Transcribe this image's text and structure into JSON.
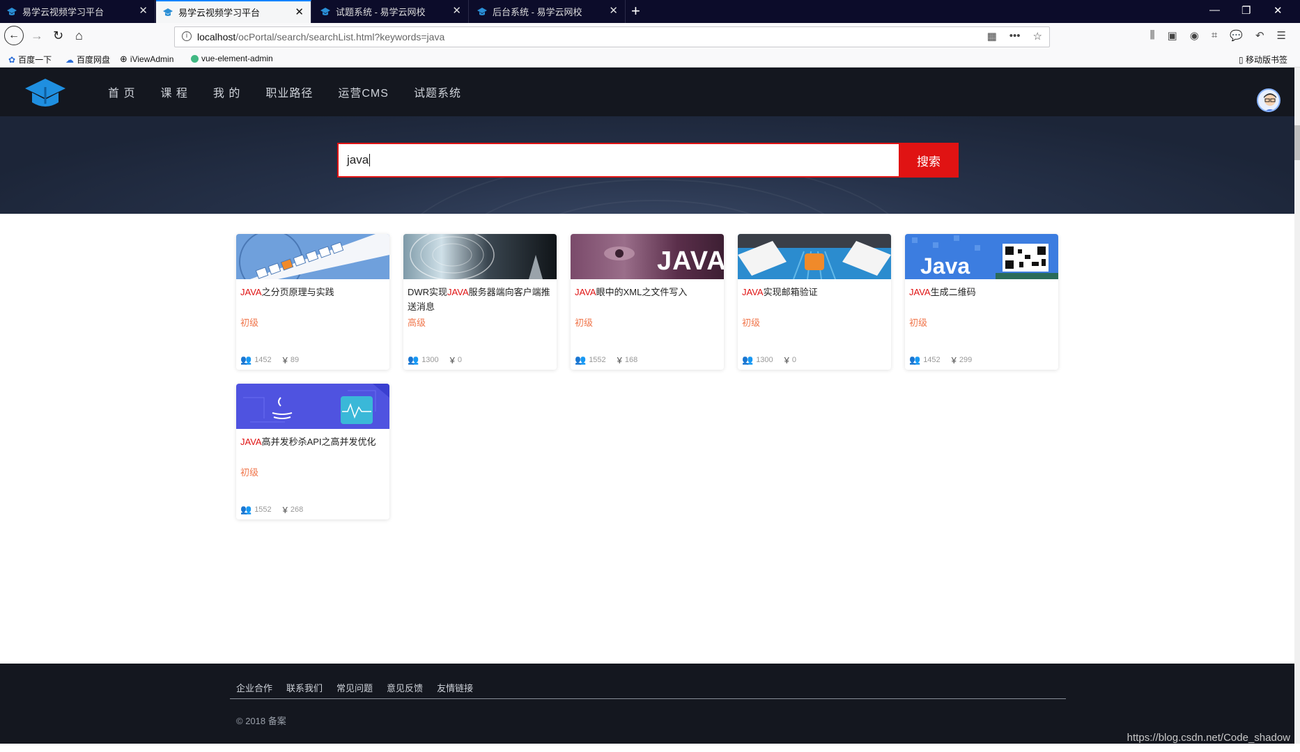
{
  "browser": {
    "tabs": [
      {
        "title": "易学云视频学习平台",
        "active": false
      },
      {
        "title": "易学云视频学习平台",
        "active": true
      },
      {
        "title": "试题系统 - 易学云网校",
        "active": false
      },
      {
        "title": "后台系统 - 易学云网校",
        "active": false
      }
    ],
    "url_host": "localhost",
    "url_path": "/ocPortal/search/searchList.html?keywords=java",
    "bookmarks": [
      "百度一下",
      "百度网盘",
      "iViewAdmin",
      "vue-element-admin"
    ],
    "mobile_bookmarks": "移动版书签"
  },
  "site": {
    "menu": [
      "首 页",
      "课 程",
      "我 的",
      "职业路径",
      "运营CMS",
      "试题系统"
    ],
    "search_value": "java",
    "search_button": "搜索"
  },
  "courses": [
    {
      "title_hl": "JAVA",
      "title_rest": "之分页原理与实践",
      "title_pre": "",
      "level": "初级",
      "students": "1452",
      "price": "89"
    },
    {
      "title_pre": "DWR实现",
      "title_hl": "JAVA",
      "title_rest": "服务器端向客户端推送消息",
      "level": "高级",
      "students": "1300",
      "price": "0"
    },
    {
      "title_pre": "",
      "title_hl": "JAVA",
      "title_rest": "眼中的XML之文件写入",
      "level": "初级",
      "students": "1552",
      "price": "168"
    },
    {
      "title_pre": "",
      "title_hl": "JAVA",
      "title_rest": "实现邮箱验证",
      "level": "初级",
      "students": "1300",
      "price": "0"
    },
    {
      "title_pre": "",
      "title_hl": "JAVA",
      "title_rest": "生成二维码",
      "level": "初级",
      "students": "1452",
      "price": "299"
    },
    {
      "title_pre": "",
      "title_hl": "JAVA",
      "title_rest": "高并发秒杀API之高并发优化",
      "level": "初级",
      "students": "1552",
      "price": "268"
    }
  ],
  "card_images": {
    "c3_text": "JAVA",
    "c5_text": "Java"
  },
  "footer": {
    "links": [
      "企业合作",
      "联系我们",
      "常见问题",
      "意见反馈",
      "友情链接"
    ],
    "copyright": "© 2018  备案"
  },
  "watermark": "https://blog.csdn.net/Code_shadow",
  "colors": {
    "accent": "#e01313",
    "header_bg": "#14171f",
    "level": "#f0774d"
  }
}
